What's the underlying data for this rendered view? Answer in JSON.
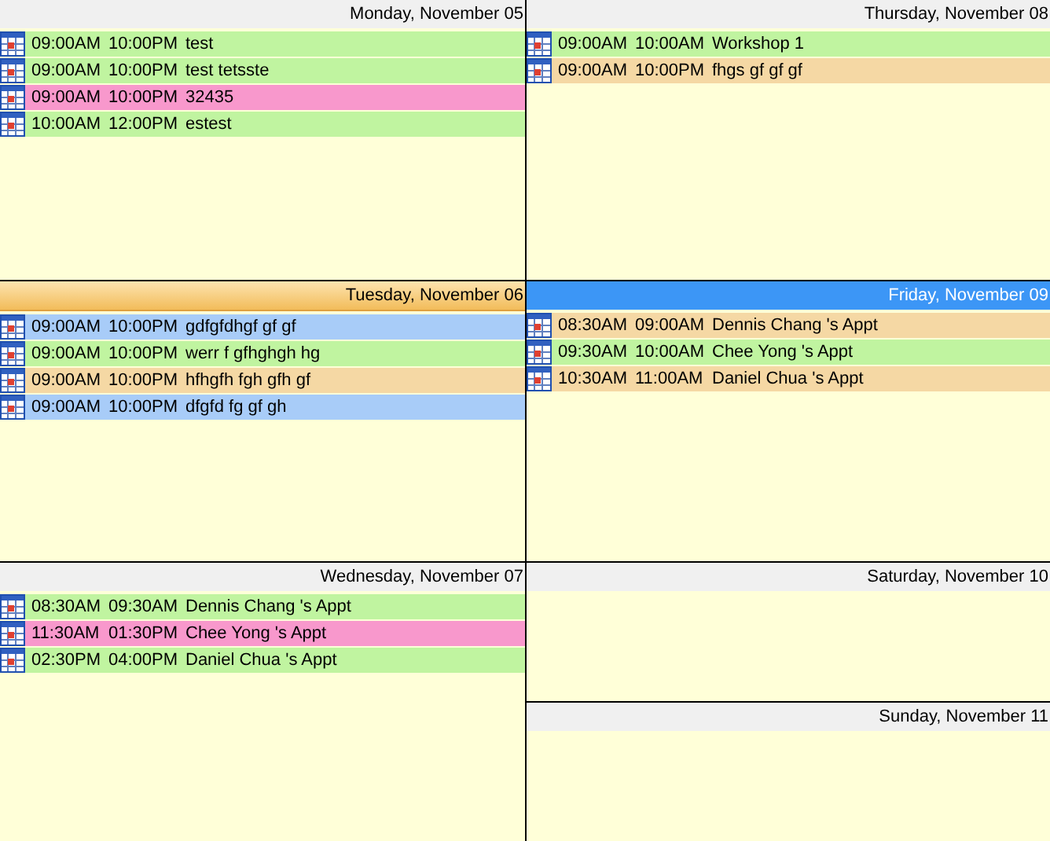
{
  "days": [
    {
      "label": "Monday, November 05",
      "selected": false,
      "today": false,
      "appointments": [
        {
          "start": "09:00AM",
          "end": "10:00PM",
          "subject": "test",
          "color": "#c0f4a0"
        },
        {
          "start": "09:00AM",
          "end": "10:00PM",
          "subject": "test tetsste",
          "color": "#c0f4a0"
        },
        {
          "start": "09:00AM",
          "end": "10:00PM",
          "subject": "32435",
          "color": "#f898cc"
        },
        {
          "start": "10:00AM",
          "end": "12:00PM",
          "subject": "estest",
          "color": "#c0f4a0"
        }
      ]
    },
    {
      "label": "Tuesday, November 06",
      "selected": false,
      "today": true,
      "appointments": [
        {
          "start": "09:00AM",
          "end": "10:00PM",
          "subject": "gdfgfdhgf gf gf",
          "color": "#a8ccf8"
        },
        {
          "start": "09:00AM",
          "end": "10:00PM",
          "subject": "werr f gfhghgh hg",
          "color": "#c0f4a0"
        },
        {
          "start": "09:00AM",
          "end": "10:00PM",
          "subject": "hfhgfh fgh gfh gf",
          "color": "#f5d8a4"
        },
        {
          "start": "09:00AM",
          "end": "10:00PM",
          "subject": "dfgfd fg gf gh",
          "color": "#a8ccf8"
        }
      ]
    },
    {
      "label": "Wednesday, November 07",
      "selected": false,
      "today": false,
      "appointments": [
        {
          "start": "08:30AM",
          "end": "09:30AM",
          "subject": "Dennis Chang 's Appt",
          "color": "#c0f4a0"
        },
        {
          "start": "11:30AM",
          "end": "01:30PM",
          "subject": "Chee Yong 's Appt",
          "color": "#f898cc"
        },
        {
          "start": "02:30PM",
          "end": "04:00PM",
          "subject": "Daniel Chua 's Appt",
          "color": "#c0f4a0"
        }
      ]
    },
    {
      "label": "Thursday, November 08",
      "selected": false,
      "today": false,
      "appointments": [
        {
          "start": "09:00AM",
          "end": "10:00AM",
          "subject": "Workshop 1",
          "color": "#c0f4a0"
        },
        {
          "start": "09:00AM",
          "end": "10:00PM",
          "subject": "fhgs gf gf gf",
          "color": "#f5d8a4"
        }
      ]
    },
    {
      "label": "Friday, November 09",
      "selected": true,
      "today": false,
      "appointments": [
        {
          "start": "08:30AM",
          "end": "09:00AM",
          "subject": "Dennis Chang 's Appt",
          "color": "#f5d8a4"
        },
        {
          "start": "09:30AM",
          "end": "10:00AM",
          "subject": "Chee Yong 's Appt",
          "color": "#c0f4a0"
        },
        {
          "start": "10:30AM",
          "end": "11:00AM",
          "subject": "Daniel Chua 's Appt",
          "color": "#f5d8a4"
        }
      ]
    },
    {
      "label": "Saturday, November 10",
      "selected": false,
      "today": false
    },
    {
      "label": "Sunday, November 11",
      "selected": false,
      "today": false
    }
  ]
}
